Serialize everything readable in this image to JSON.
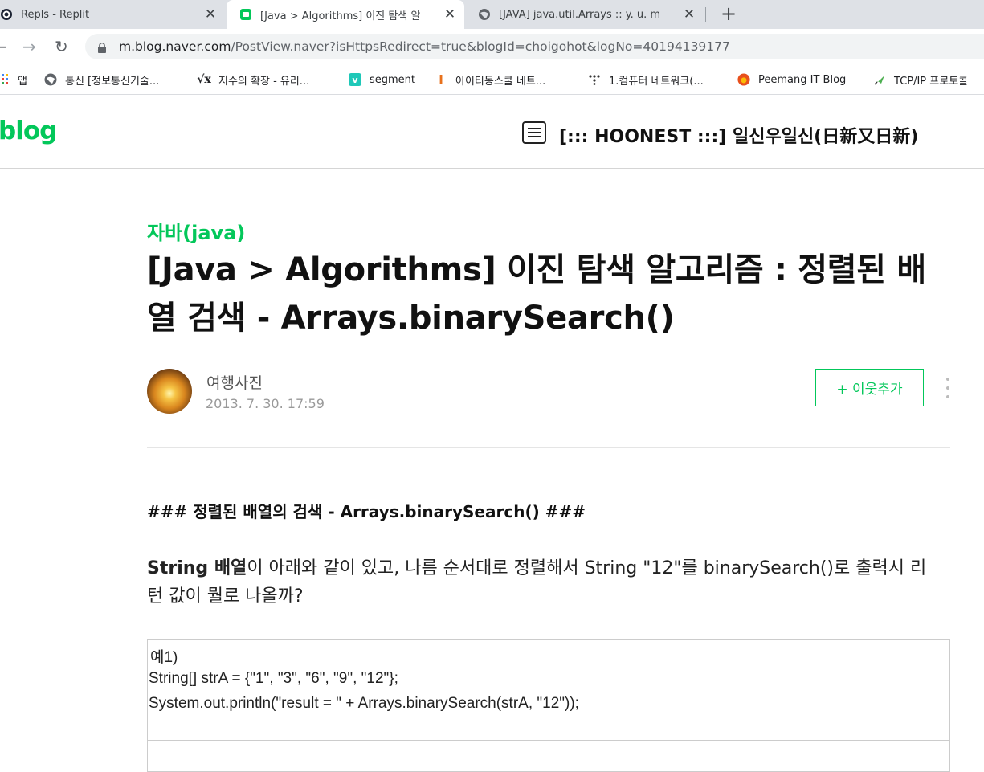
{
  "browser": {
    "tabs": [
      {
        "title": "Repls - Replit",
        "icon": "replit-icon",
        "active": false
      },
      {
        "title": "[Java > Algorithms] 이진 탐색 알",
        "icon": "naver-blog-icon",
        "active": true
      },
      {
        "title": "[JAVA] java.util.Arrays :: y. u. m",
        "icon": "globe-icon",
        "active": false
      }
    ],
    "close_glyph": "✕",
    "new_tab_glyph": "+",
    "nav": {
      "back": "←",
      "forward": "→",
      "reload": "↻"
    },
    "url_host": "m.blog.naver.com",
    "url_path": "/PostView.naver?isHttpsRedirect=true&blogId=choigohot&logNo=40194139177",
    "bookmarks": [
      {
        "label": "앱",
        "icon": "apps-grid-icon"
      },
      {
        "label": "통신 [정보통신기술...",
        "icon": "globe-icon"
      },
      {
        "label": "지수의 확장 - 유리...",
        "icon": "math-sqrt-icon"
      },
      {
        "label": "segment",
        "icon": "v-icon"
      },
      {
        "label": "아이티동스쿨 네트...",
        "icon": "it-logo-icon"
      },
      {
        "label": "1.컴퓨터 네트워크(...",
        "icon": "dots-icon"
      },
      {
        "label": "Peemang IT Blog",
        "icon": "peemang-icon"
      },
      {
        "label": "TCP/IP 프로토콜",
        "icon": "brush-icon"
      }
    ]
  },
  "blog": {
    "logo": "blog",
    "blog_title": "[::: HOONEST :::] 일신우일신(日新又日新)",
    "category": "자바(java)",
    "post_title": "[Java > Algorithms] 이진 탐색 알고리즘 : 정렬된 배열 검색 - Arrays.binarySearch()",
    "author": "여행사진",
    "date": "2013. 7. 30. 17:59",
    "add_neighbor": "+ 이웃추가",
    "heading": "### 정렬된 배열의 검색 - Arrays.binarySearch() ###",
    "para_bold": "String 배열",
    "para_rest": "이 아래와 같이 있고, 나름 순서대로 정렬해서 String \"12\"를 binarySearch()로 출력시 리턴 값이 뭘로 나올까?",
    "code_lines": [
      " 예1)",
      "String[] strA = {\"1\", \"3\", \"6\", \"9\", \"12\"};",
      "System.out.println(\"result = \" + Arrays.binarySearch(strA, \"12\"));"
    ]
  },
  "colors": {
    "naver_green": "#03c75a",
    "tabstrip": "#dee1e6",
    "omnibox": "#f1f3f4"
  }
}
